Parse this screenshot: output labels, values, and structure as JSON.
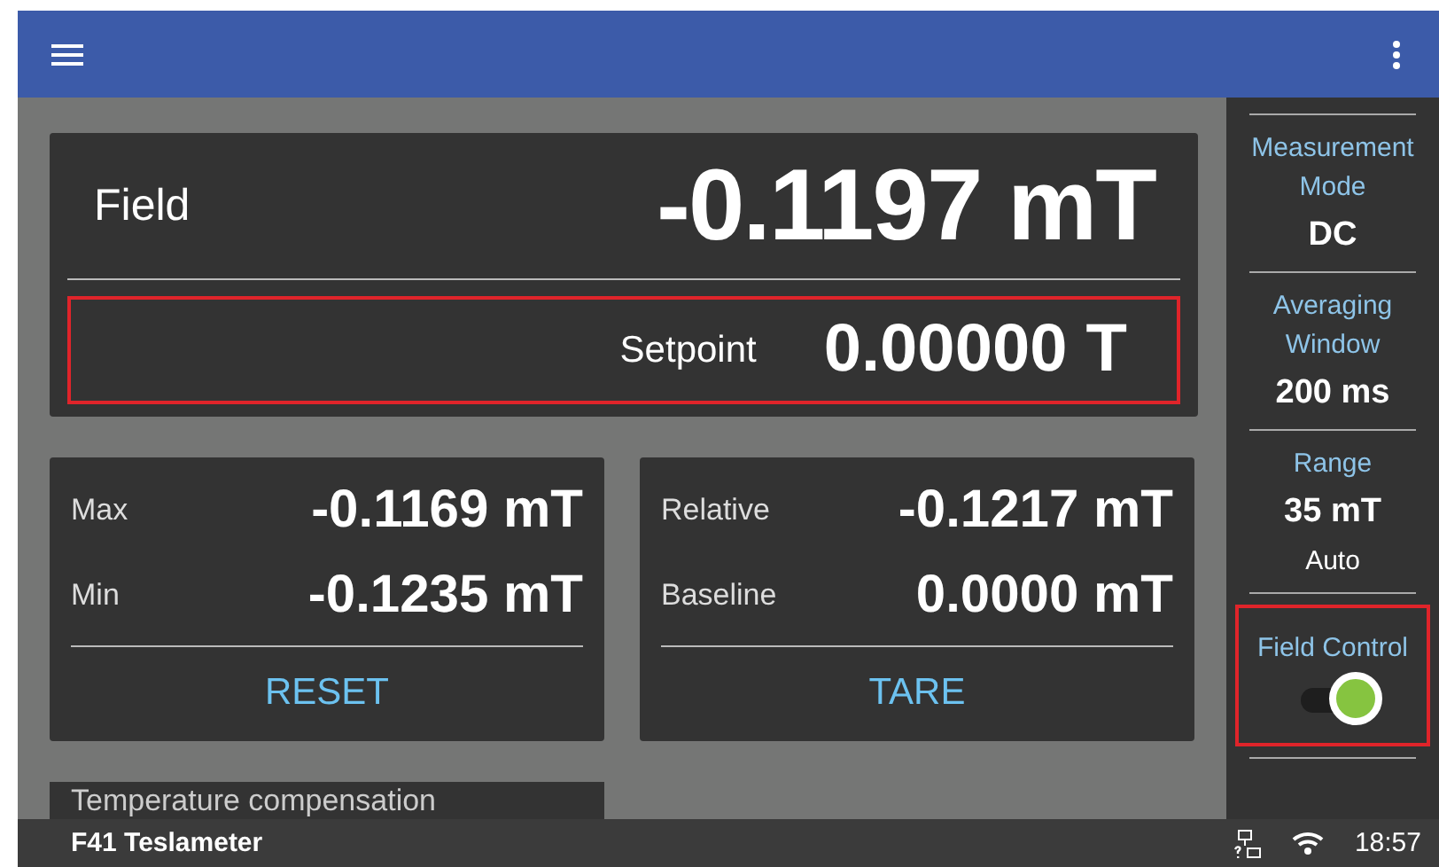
{
  "field": {
    "label": "Field",
    "value": "-0.1197 mT"
  },
  "setpoint": {
    "label": "Setpoint",
    "value": "0.00000 T",
    "highlighted": true
  },
  "cards": [
    {
      "rows": [
        {
          "label": "Max",
          "value": "-0.1169 mT"
        },
        {
          "label": "Min",
          "value": "-0.1235 mT"
        }
      ],
      "action": "RESET"
    },
    {
      "rows": [
        {
          "label": "Relative",
          "value": "-0.1217 mT"
        },
        {
          "label": "Baseline",
          "value": "0.0000 mT"
        }
      ],
      "action": "TARE"
    }
  ],
  "partial_card": {
    "title": "Temperature compensation"
  },
  "sidebar": [
    {
      "kind": "setting",
      "label": "Measurement Mode",
      "value": "DC"
    },
    {
      "kind": "setting",
      "label": "Averaging Window",
      "value": "200 ms"
    },
    {
      "kind": "setting",
      "label": "Range",
      "value": "35 mT",
      "note": "Auto"
    },
    {
      "kind": "toggle",
      "label": "Field Control",
      "on": true,
      "highlighted": true
    }
  ],
  "status_bar": {
    "app_name": "F41 Teslameter",
    "time": "18:57"
  }
}
